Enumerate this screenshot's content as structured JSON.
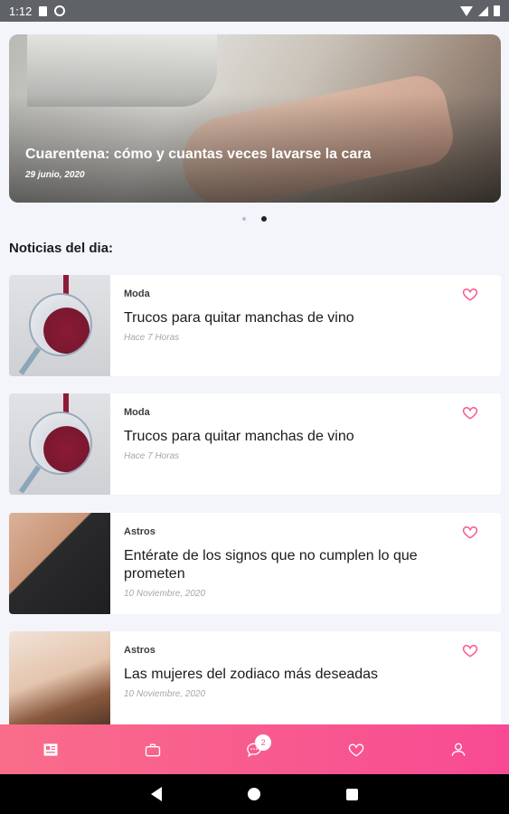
{
  "status_bar": {
    "time": "1:12",
    "icons": [
      "sd-card-icon",
      "sync-icon",
      "wifi-icon",
      "signal-icon",
      "battery-icon"
    ]
  },
  "hero": {
    "title": "Cuarentena: cómo y cuantas veces lavarse la cara",
    "date": "29 junio, 2020",
    "pages": 2,
    "active_page": 2
  },
  "section_title": "Noticias del dia:",
  "news": [
    {
      "category": "Moda",
      "title": "Trucos para quitar manchas de vino",
      "time": "Hace 7 Horas",
      "image": "wine-glass-image"
    },
    {
      "category": "Moda",
      "title": "Trucos para quitar manchas de vino",
      "time": "Hace 7 Horas",
      "image": "wine-glass-image"
    },
    {
      "category": "Astros",
      "title": "Entérate de los signos que no cumplen lo que prometen",
      "time": "10 Noviembre, 2020",
      "image": "couple-image"
    },
    {
      "category": "Astros",
      "title": "Las mujeres del zodiaco más deseadas",
      "time": "10 Noviembre, 2020",
      "image": "woman-massage-image"
    }
  ],
  "bottom_nav": {
    "items": [
      "news-icon",
      "briefcase-icon",
      "chat-icon",
      "heart-icon",
      "user-icon"
    ],
    "chat_badge": "2",
    "active_item": "news-icon"
  },
  "colors": {
    "accent": "#f85b8f",
    "nav_gradient_start": "#f96d8a",
    "nav_gradient_end": "#f84a93",
    "background": "#f3f5fb"
  }
}
